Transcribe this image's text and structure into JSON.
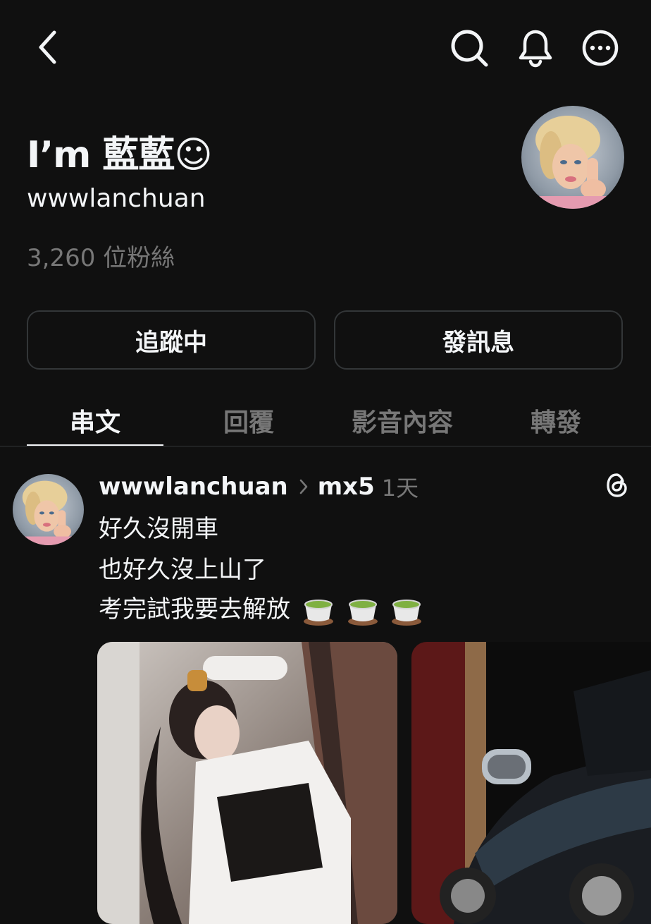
{
  "topbar": {
    "back_icon": "chevron-left-icon",
    "search_icon": "search-icon",
    "bell_icon": "bell-icon",
    "more_icon": "more-horizontal-icon"
  },
  "profile": {
    "name": "I’m 藍藍☺︎",
    "handle": "wwwlanchuan",
    "followers": "3,260 位粉絲",
    "avatar_description_icon": "avatar-image"
  },
  "actions": {
    "following_label": "追蹤中",
    "message_label": "發訊息"
  },
  "tabs": [
    {
      "label": "串文",
      "active": true
    },
    {
      "label": "回覆",
      "active": false
    },
    {
      "label": "影音內容",
      "active": false
    },
    {
      "label": "轉發",
      "active": false
    }
  ],
  "post": {
    "username": "wwwlanchuan",
    "topic": "mx5",
    "time": "1天",
    "lines": [
      "好久沒開車",
      "也好久沒上山了",
      "考完試我要去解放"
    ],
    "emoji_icons": [
      "tea-cup-icon",
      "tea-cup-icon",
      "tea-cup-icon"
    ],
    "threads_icon": "threads-logo-icon"
  },
  "colors": {
    "background": "#101010",
    "text_primary": "#f3f5f7",
    "text_secondary": "#777777",
    "border": "#333638"
  }
}
